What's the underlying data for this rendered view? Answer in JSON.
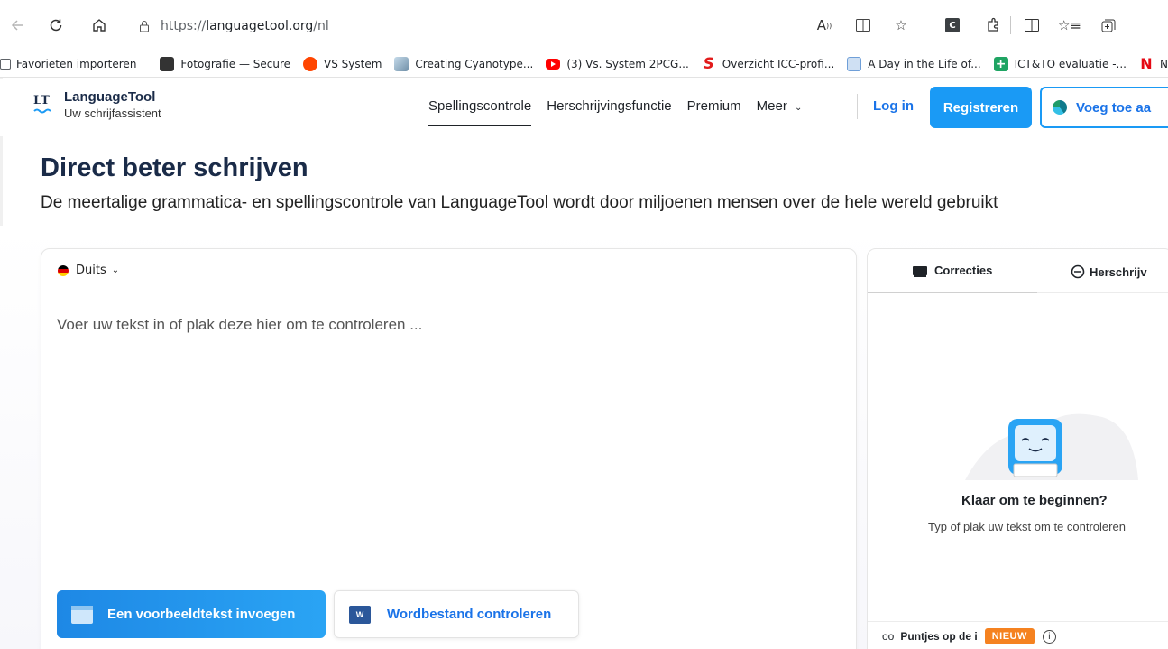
{
  "browser": {
    "url_prefix": "https://",
    "url_host": "languagetool.org",
    "url_path": "/nl",
    "bookmarks": [
      {
        "label": "Favorieten importeren",
        "color": "#5f6368"
      },
      {
        "label": "Fotografie — Secure",
        "color": "#333333"
      },
      {
        "label": "VS System",
        "color": "#ff4500"
      },
      {
        "label": "Creating Cyanotype...",
        "color": "#7aa7c7"
      },
      {
        "label": "(3) Vs. System 2PCG...",
        "color": "#ff0000"
      },
      {
        "label": "Overzicht ICC-profi...",
        "color": "#e21b1b"
      },
      {
        "label": "A Day in the Life of...",
        "color": "#6f9fd8"
      },
      {
        "label": "ICT&TO evaluatie -...",
        "color": "#1fa463"
      },
      {
        "label": "N",
        "color": "#e50914"
      }
    ]
  },
  "site": {
    "logo_title": "LanguageTool",
    "logo_subtitle": "Uw schrijfassistent",
    "nav": [
      "Spellingscontrole",
      "Herschrijvingsfunctie",
      "Premium",
      "Meer"
    ],
    "login": "Log in",
    "register": "Registreren",
    "add_button": "Voeg toe aa"
  },
  "hero": {
    "title": "Direct beter schrijven",
    "subtitle": "De meertalige grammatica- en spellingscontrole van LanguageTool wordt door miljoenen mensen over de hele wereld gebruikt"
  },
  "editor": {
    "language": "Duits",
    "placeholder": "Voer uw tekst in of plak deze hier om te controleren ...",
    "sample_button": "Een voorbeeldtekst invoegen",
    "word_button": "Wordbestand controleren"
  },
  "side": {
    "tab_corrections": "Correcties",
    "tab_rewrite": "Herschrijv",
    "ready_title": "Klaar om te beginnen?",
    "ready_sub": "Typ of plak uw tekst om te controleren",
    "dots_label": "Puntjes op de i",
    "badge": "NIEUW"
  },
  "colors": {
    "brand_blue": "#1a9af5",
    "link_blue": "#1a73e8",
    "badge_orange": "#f58220",
    "title_navy": "#1a2b48"
  }
}
